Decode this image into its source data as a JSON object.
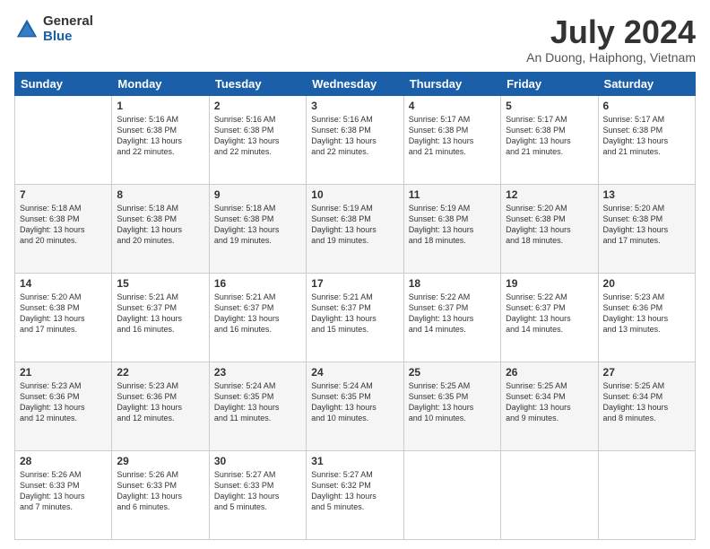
{
  "header": {
    "logo_general": "General",
    "logo_blue": "Blue",
    "title": "July 2024",
    "subtitle": "An Duong, Haiphong, Vietnam"
  },
  "calendar": {
    "days_of_week": [
      "Sunday",
      "Monday",
      "Tuesday",
      "Wednesday",
      "Thursday",
      "Friday",
      "Saturday"
    ],
    "weeks": [
      [
        {
          "day": "",
          "info": ""
        },
        {
          "day": "1",
          "info": "Sunrise: 5:16 AM\nSunset: 6:38 PM\nDaylight: 13 hours\nand 22 minutes."
        },
        {
          "day": "2",
          "info": "Sunrise: 5:16 AM\nSunset: 6:38 PM\nDaylight: 13 hours\nand 22 minutes."
        },
        {
          "day": "3",
          "info": "Sunrise: 5:16 AM\nSunset: 6:38 PM\nDaylight: 13 hours\nand 22 minutes."
        },
        {
          "day": "4",
          "info": "Sunrise: 5:17 AM\nSunset: 6:38 PM\nDaylight: 13 hours\nand 21 minutes."
        },
        {
          "day": "5",
          "info": "Sunrise: 5:17 AM\nSunset: 6:38 PM\nDaylight: 13 hours\nand 21 minutes."
        },
        {
          "day": "6",
          "info": "Sunrise: 5:17 AM\nSunset: 6:38 PM\nDaylight: 13 hours\nand 21 minutes."
        }
      ],
      [
        {
          "day": "7",
          "info": "Sunrise: 5:18 AM\nSunset: 6:38 PM\nDaylight: 13 hours\nand 20 minutes."
        },
        {
          "day": "8",
          "info": "Sunrise: 5:18 AM\nSunset: 6:38 PM\nDaylight: 13 hours\nand 20 minutes."
        },
        {
          "day": "9",
          "info": "Sunrise: 5:18 AM\nSunset: 6:38 PM\nDaylight: 13 hours\nand 19 minutes."
        },
        {
          "day": "10",
          "info": "Sunrise: 5:19 AM\nSunset: 6:38 PM\nDaylight: 13 hours\nand 19 minutes."
        },
        {
          "day": "11",
          "info": "Sunrise: 5:19 AM\nSunset: 6:38 PM\nDaylight: 13 hours\nand 18 minutes."
        },
        {
          "day": "12",
          "info": "Sunrise: 5:20 AM\nSunset: 6:38 PM\nDaylight: 13 hours\nand 18 minutes."
        },
        {
          "day": "13",
          "info": "Sunrise: 5:20 AM\nSunset: 6:38 PM\nDaylight: 13 hours\nand 17 minutes."
        }
      ],
      [
        {
          "day": "14",
          "info": "Sunrise: 5:20 AM\nSunset: 6:38 PM\nDaylight: 13 hours\nand 17 minutes."
        },
        {
          "day": "15",
          "info": "Sunrise: 5:21 AM\nSunset: 6:37 PM\nDaylight: 13 hours\nand 16 minutes."
        },
        {
          "day": "16",
          "info": "Sunrise: 5:21 AM\nSunset: 6:37 PM\nDaylight: 13 hours\nand 16 minutes."
        },
        {
          "day": "17",
          "info": "Sunrise: 5:21 AM\nSunset: 6:37 PM\nDaylight: 13 hours\nand 15 minutes."
        },
        {
          "day": "18",
          "info": "Sunrise: 5:22 AM\nSunset: 6:37 PM\nDaylight: 13 hours\nand 14 minutes."
        },
        {
          "day": "19",
          "info": "Sunrise: 5:22 AM\nSunset: 6:37 PM\nDaylight: 13 hours\nand 14 minutes."
        },
        {
          "day": "20",
          "info": "Sunrise: 5:23 AM\nSunset: 6:36 PM\nDaylight: 13 hours\nand 13 minutes."
        }
      ],
      [
        {
          "day": "21",
          "info": "Sunrise: 5:23 AM\nSunset: 6:36 PM\nDaylight: 13 hours\nand 12 minutes."
        },
        {
          "day": "22",
          "info": "Sunrise: 5:23 AM\nSunset: 6:36 PM\nDaylight: 13 hours\nand 12 minutes."
        },
        {
          "day": "23",
          "info": "Sunrise: 5:24 AM\nSunset: 6:35 PM\nDaylight: 13 hours\nand 11 minutes."
        },
        {
          "day": "24",
          "info": "Sunrise: 5:24 AM\nSunset: 6:35 PM\nDaylight: 13 hours\nand 10 minutes."
        },
        {
          "day": "25",
          "info": "Sunrise: 5:25 AM\nSunset: 6:35 PM\nDaylight: 13 hours\nand 10 minutes."
        },
        {
          "day": "26",
          "info": "Sunrise: 5:25 AM\nSunset: 6:34 PM\nDaylight: 13 hours\nand 9 minutes."
        },
        {
          "day": "27",
          "info": "Sunrise: 5:25 AM\nSunset: 6:34 PM\nDaylight: 13 hours\nand 8 minutes."
        }
      ],
      [
        {
          "day": "28",
          "info": "Sunrise: 5:26 AM\nSunset: 6:33 PM\nDaylight: 13 hours\nand 7 minutes."
        },
        {
          "day": "29",
          "info": "Sunrise: 5:26 AM\nSunset: 6:33 PM\nDaylight: 13 hours\nand 6 minutes."
        },
        {
          "day": "30",
          "info": "Sunrise: 5:27 AM\nSunset: 6:33 PM\nDaylight: 13 hours\nand 5 minutes."
        },
        {
          "day": "31",
          "info": "Sunrise: 5:27 AM\nSunset: 6:32 PM\nDaylight: 13 hours\nand 5 minutes."
        },
        {
          "day": "",
          "info": ""
        },
        {
          "day": "",
          "info": ""
        },
        {
          "day": "",
          "info": ""
        }
      ]
    ]
  }
}
